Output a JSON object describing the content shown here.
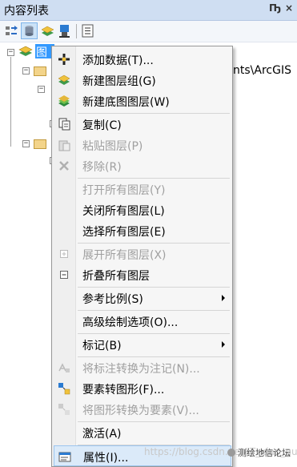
{
  "panel": {
    "title": "内容列表",
    "pin_glyph": "Ҧ",
    "close_glyph": "×"
  },
  "toolbar": {
    "buttons": [
      {
        "icon": "list-by-drawing-order-icon"
      },
      {
        "icon": "list-by-source-icon",
        "active": true
      },
      {
        "icon": "list-by-visibility-icon"
      },
      {
        "icon": "list-by-selection-icon"
      },
      {
        "icon": "options-icon"
      }
    ]
  },
  "tree": {
    "root_label": "图层",
    "path_fragment": "nts\\ArcGIS"
  },
  "menu": {
    "items": [
      {
        "label": "添加数据(T)...",
        "icon": "add-data-icon",
        "enabled": true
      },
      {
        "label": "新建图层组(G)",
        "icon": "new-group-layer-icon",
        "enabled": true
      },
      {
        "label": "新建底图图层(W)",
        "icon": "new-basemap-layer-icon",
        "enabled": true
      },
      {
        "label": "复制(C)",
        "icon": "copy-icon",
        "enabled": true
      },
      {
        "label": "粘贴图层(P)",
        "icon": "paste-icon",
        "enabled": false
      },
      {
        "label": "移除(R)",
        "icon": "remove-icon",
        "enabled": false
      },
      {
        "label": "打开所有图层(Y)",
        "icon": "",
        "enabled": false
      },
      {
        "label": "关闭所有图层(L)",
        "icon": "",
        "enabled": true
      },
      {
        "label": "选择所有图层(E)",
        "icon": "",
        "enabled": true
      },
      {
        "label": "展开所有图层(X)",
        "icon": "expand-icon",
        "enabled": false
      },
      {
        "label": "折叠所有图层",
        "icon": "collapse-icon",
        "enabled": true
      },
      {
        "label": "参考比例(S)",
        "icon": "",
        "enabled": true,
        "submenu": true
      },
      {
        "label": "高级绘制选项(O)...",
        "icon": "",
        "enabled": true
      },
      {
        "label": "标记(B)",
        "icon": "",
        "enabled": true,
        "submenu": true
      },
      {
        "label": "将标注转换为注记(N)...",
        "icon": "convert-labels-icon",
        "enabled": false
      },
      {
        "label": "要素转图形(F)...",
        "icon": "features-to-graphics-icon",
        "enabled": true
      },
      {
        "label": "将图形转换为要素(V)...",
        "icon": "graphics-to-features-icon",
        "enabled": false
      },
      {
        "label": "激活(A)",
        "icon": "",
        "enabled": true
      },
      {
        "label": "属性(I)...",
        "icon": "properties-icon",
        "enabled": true,
        "highlighted": true
      }
    ]
  },
  "watermark": {
    "url_text": "https://blog.csdn.net/IT_xiao_gu",
    "brand_text": "测绘地信论坛"
  },
  "colors": {
    "title_bar": "#cfdef2",
    "selection_blue": "#3399ff",
    "menu_highlight": "#dbeaf9",
    "disabled_text": "#a0a0a0"
  }
}
